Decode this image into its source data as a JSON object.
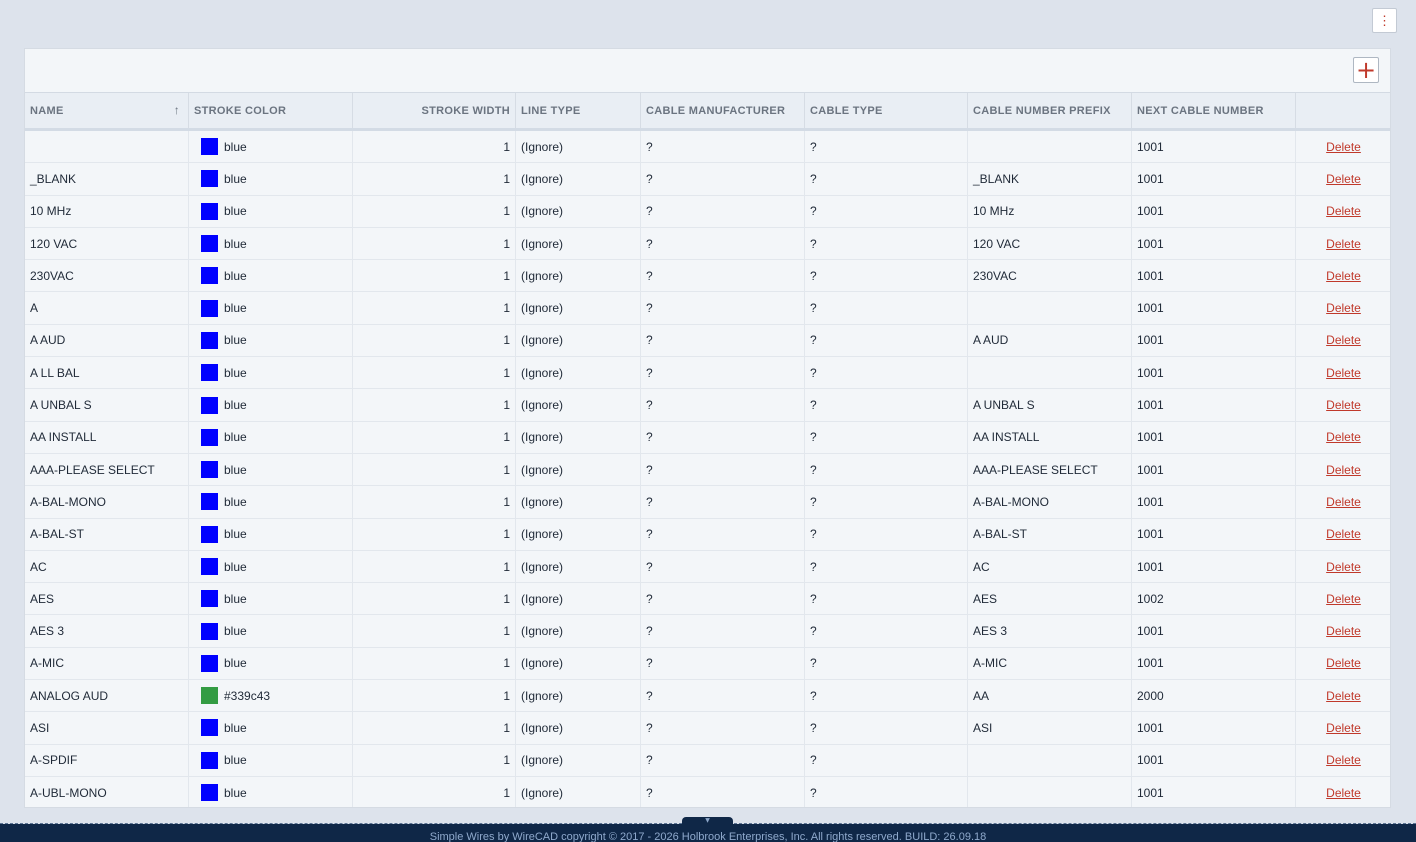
{
  "menu": {
    "icon": "kebab-vertical-icon",
    "label": "⋮"
  },
  "toolbar": {
    "add_icon": "plus-icon",
    "add_label": "+"
  },
  "table": {
    "columns": [
      {
        "key": "name",
        "label": "NAME",
        "sorted": "ascending"
      },
      {
        "key": "stroke_color",
        "label": "STROKE COLOR"
      },
      {
        "key": "stroke_width",
        "label": "STROKE WIDTH"
      },
      {
        "key": "line_type",
        "label": "LINE TYPE"
      },
      {
        "key": "cable_manufacturer",
        "label": "CABLE MANUFACTURER"
      },
      {
        "key": "cable_type",
        "label": "CABLE TYPE"
      },
      {
        "key": "cable_number_prefix",
        "label": "CABLE NUMBER PREFIX"
      },
      {
        "key": "next_cable_number",
        "label": "NEXT CABLE NUMBER"
      },
      {
        "key": "action",
        "label": ""
      }
    ],
    "sort_icon": "↑",
    "delete_label": "Delete",
    "rows": [
      {
        "name": "",
        "color_label": "blue",
        "color": "#0000ff",
        "width": "1",
        "line_type": "(Ignore)",
        "manufacturer": "?",
        "cable_type": "?",
        "prefix": "",
        "next": "1001"
      },
      {
        "name": "_BLANK",
        "color_label": "blue",
        "color": "#0000ff",
        "width": "1",
        "line_type": "(Ignore)",
        "manufacturer": "?",
        "cable_type": "?",
        "prefix": "_BLANK",
        "next": "1001"
      },
      {
        "name": "10 MHz",
        "color_label": "blue",
        "color": "#0000ff",
        "width": "1",
        "line_type": "(Ignore)",
        "manufacturer": "?",
        "cable_type": "?",
        "prefix": "10 MHz",
        "next": "1001"
      },
      {
        "name": "120 VAC",
        "color_label": "blue",
        "color": "#0000ff",
        "width": "1",
        "line_type": "(Ignore)",
        "manufacturer": "?",
        "cable_type": "?",
        "prefix": "120 VAC",
        "next": "1001"
      },
      {
        "name": "230VAC",
        "color_label": "blue",
        "color": "#0000ff",
        "width": "1",
        "line_type": "(Ignore)",
        "manufacturer": "?",
        "cable_type": "?",
        "prefix": "230VAC",
        "next": "1001"
      },
      {
        "name": "A",
        "color_label": "blue",
        "color": "#0000ff",
        "width": "1",
        "line_type": "(Ignore)",
        "manufacturer": "?",
        "cable_type": "?",
        "prefix": "",
        "next": "1001"
      },
      {
        "name": "A AUD",
        "color_label": "blue",
        "color": "#0000ff",
        "width": "1",
        "line_type": "(Ignore)",
        "manufacturer": "?",
        "cable_type": "?",
        "prefix": "A AUD",
        "next": "1001"
      },
      {
        "name": "A LL BAL",
        "color_label": "blue",
        "color": "#0000ff",
        "width": "1",
        "line_type": "(Ignore)",
        "manufacturer": "?",
        "cable_type": "?",
        "prefix": "",
        "next": "1001"
      },
      {
        "name": "A UNBAL S",
        "color_label": "blue",
        "color": "#0000ff",
        "width": "1",
        "line_type": "(Ignore)",
        "manufacturer": "?",
        "cable_type": "?",
        "prefix": "A UNBAL S",
        "next": "1001"
      },
      {
        "name": "AA INSTALL",
        "color_label": "blue",
        "color": "#0000ff",
        "width": "1",
        "line_type": "(Ignore)",
        "manufacturer": "?",
        "cable_type": "?",
        "prefix": "AA INSTALL",
        "next": "1001"
      },
      {
        "name": "AAA-PLEASE SELECT",
        "color_label": "blue",
        "color": "#0000ff",
        "width": "1",
        "line_type": "(Ignore)",
        "manufacturer": "?",
        "cable_type": "?",
        "prefix": "AAA-PLEASE SELECT",
        "next": "1001"
      },
      {
        "name": "A-BAL-MONO",
        "color_label": "blue",
        "color": "#0000ff",
        "width": "1",
        "line_type": "(Ignore)",
        "manufacturer": "?",
        "cable_type": "?",
        "prefix": "A-BAL-MONO",
        "next": "1001"
      },
      {
        "name": "A-BAL-ST",
        "color_label": "blue",
        "color": "#0000ff",
        "width": "1",
        "line_type": "(Ignore)",
        "manufacturer": "?",
        "cable_type": "?",
        "prefix": "A-BAL-ST",
        "next": "1001"
      },
      {
        "name": "AC",
        "color_label": "blue",
        "color": "#0000ff",
        "width": "1",
        "line_type": "(Ignore)",
        "manufacturer": "?",
        "cable_type": "?",
        "prefix": "AC",
        "next": "1001"
      },
      {
        "name": "AES",
        "color_label": "blue",
        "color": "#0000ff",
        "width": "1",
        "line_type": "(Ignore)",
        "manufacturer": "?",
        "cable_type": "?",
        "prefix": "AES",
        "next": "1002"
      },
      {
        "name": "AES 3",
        "color_label": "blue",
        "color": "#0000ff",
        "width": "1",
        "line_type": "(Ignore)",
        "manufacturer": "?",
        "cable_type": "?",
        "prefix": "AES 3",
        "next": "1001"
      },
      {
        "name": "A-MIC",
        "color_label": "blue",
        "color": "#0000ff",
        "width": "1",
        "line_type": "(Ignore)",
        "manufacturer": "?",
        "cable_type": "?",
        "prefix": "A-MIC",
        "next": "1001"
      },
      {
        "name": "ANALOG AUD",
        "color_label": "#339c43",
        "color": "#339c43",
        "width": "1",
        "line_type": "(Ignore)",
        "manufacturer": "?",
        "cable_type": "?",
        "prefix": "AA",
        "next": "2000"
      },
      {
        "name": "ASI",
        "color_label": "blue",
        "color": "#0000ff",
        "width": "1",
        "line_type": "(Ignore)",
        "manufacturer": "?",
        "cable_type": "?",
        "prefix": "ASI",
        "next": "1001"
      },
      {
        "name": "A-SPDIF",
        "color_label": "blue",
        "color": "#0000ff",
        "width": "1",
        "line_type": "(Ignore)",
        "manufacturer": "?",
        "cable_type": "?",
        "prefix": "",
        "next": "1001"
      },
      {
        "name": "A-UBL-MONO",
        "color_label": "blue",
        "color": "#0000ff",
        "width": "1",
        "line_type": "(Ignore)",
        "manufacturer": "?",
        "cable_type": "?",
        "prefix": "",
        "next": "1001"
      }
    ]
  },
  "collapse": {
    "icon": "chevron-down-icon",
    "label": "▼"
  },
  "footer": {
    "text": "Simple Wires by WireCAD copyright © 2017 - 2026 Holbrook Enterprises, Inc. All rights reserved. BUILD: 26.09.18"
  }
}
